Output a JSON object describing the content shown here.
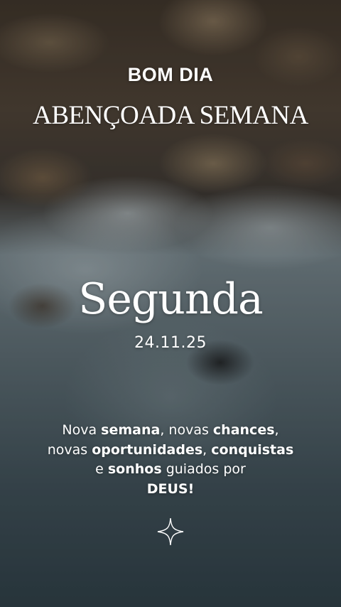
{
  "greeting": "BOM DIA",
  "subtitle": "ABENÇOADA SEMANA",
  "weekday": "Segunda",
  "date": "24.11.25",
  "message": {
    "line1": [
      {
        "text": "Nova ",
        "bold": false
      },
      {
        "text": "semana",
        "bold": true
      },
      {
        "text": ", novas ",
        "bold": false
      },
      {
        "text": "chances",
        "bold": true
      },
      {
        "text": ",",
        "bold": false
      }
    ],
    "line2": [
      {
        "text": "novas ",
        "bold": false
      },
      {
        "text": "oportunidades",
        "bold": true
      },
      {
        "text": ", ",
        "bold": false
      },
      {
        "text": "conquistas",
        "bold": true
      }
    ],
    "line3": [
      {
        "text": "e ",
        "bold": false
      },
      {
        "text": "sonhos",
        "bold": true
      },
      {
        "text": " guiados por",
        "bold": false
      }
    ],
    "line4": [
      {
        "text": "DEUS!",
        "bold": true
      }
    ]
  },
  "icons": {
    "decoration": "sparkle-icon"
  },
  "colors": {
    "text": "#ffffff"
  }
}
